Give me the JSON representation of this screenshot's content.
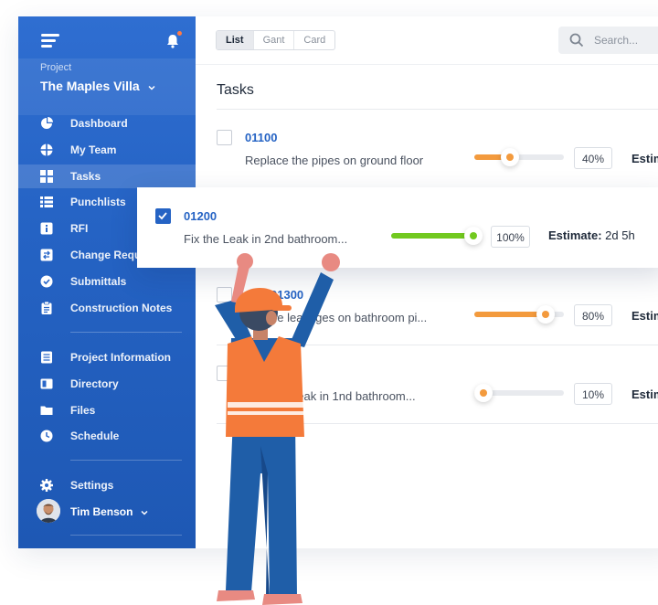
{
  "sidebar": {
    "project_label": "Project",
    "project_name": "The Maples Villa",
    "nav_primary": [
      {
        "label": "Dashboard",
        "icon": "pie-chart-icon"
      },
      {
        "label": "My Team",
        "icon": "team-icon"
      },
      {
        "label": "Tasks",
        "icon": "grid-icon",
        "active": true
      },
      {
        "label": "Punchlists",
        "icon": "list-icon"
      },
      {
        "label": "RFI",
        "icon": "info-icon"
      },
      {
        "label": "Change Requ",
        "icon": "change-icon"
      },
      {
        "label": "Submittals",
        "icon": "check-circle-icon"
      },
      {
        "label": "Construction Notes",
        "icon": "clipboard-icon"
      }
    ],
    "nav_secondary": [
      {
        "label": "Project Information",
        "icon": "document-icon"
      },
      {
        "label": "Directory",
        "icon": "book-icon"
      },
      {
        "label": "Files",
        "icon": "folder-icon"
      },
      {
        "label": "Schedule",
        "icon": "clock-icon"
      }
    ],
    "settings_label": "Settings",
    "user_name": "Tim Benson"
  },
  "topbar": {
    "views": [
      "List",
      "Gant",
      "Card"
    ],
    "selected_view": "List",
    "search_placeholder": "Search..."
  },
  "main": {
    "title": "Tasks",
    "tasks": [
      {
        "id": "01100",
        "desc": "Replace the pipes on ground floor",
        "progress": 40,
        "pct_label": "40%",
        "estimate_label": "Estim",
        "checked": false
      },
      {
        "id": "01200",
        "desc": "Fix the Leak in 2nd bathroom...",
        "progress": 100,
        "pct_label": "100%",
        "estimate_label": "Estimate:",
        "estimate_value": "2d 5h",
        "checked": true
      },
      {
        "id": "01300",
        "desc": "he leakages on bathroom pi...",
        "progress": 80,
        "pct_label": "80%",
        "estimate_label": "Estim",
        "checked": false
      },
      {
        "id": "",
        "desc": "Leak in 1nd bathroom...",
        "progress": 10,
        "pct_label": "10%",
        "estimate_label": "Estim",
        "checked": false
      }
    ]
  },
  "colors": {
    "sidebar_blue": "#2563c4",
    "accent_orange": "#f39a3d",
    "accent_green": "#72c91f",
    "task_id_blue": "#2563c4"
  }
}
